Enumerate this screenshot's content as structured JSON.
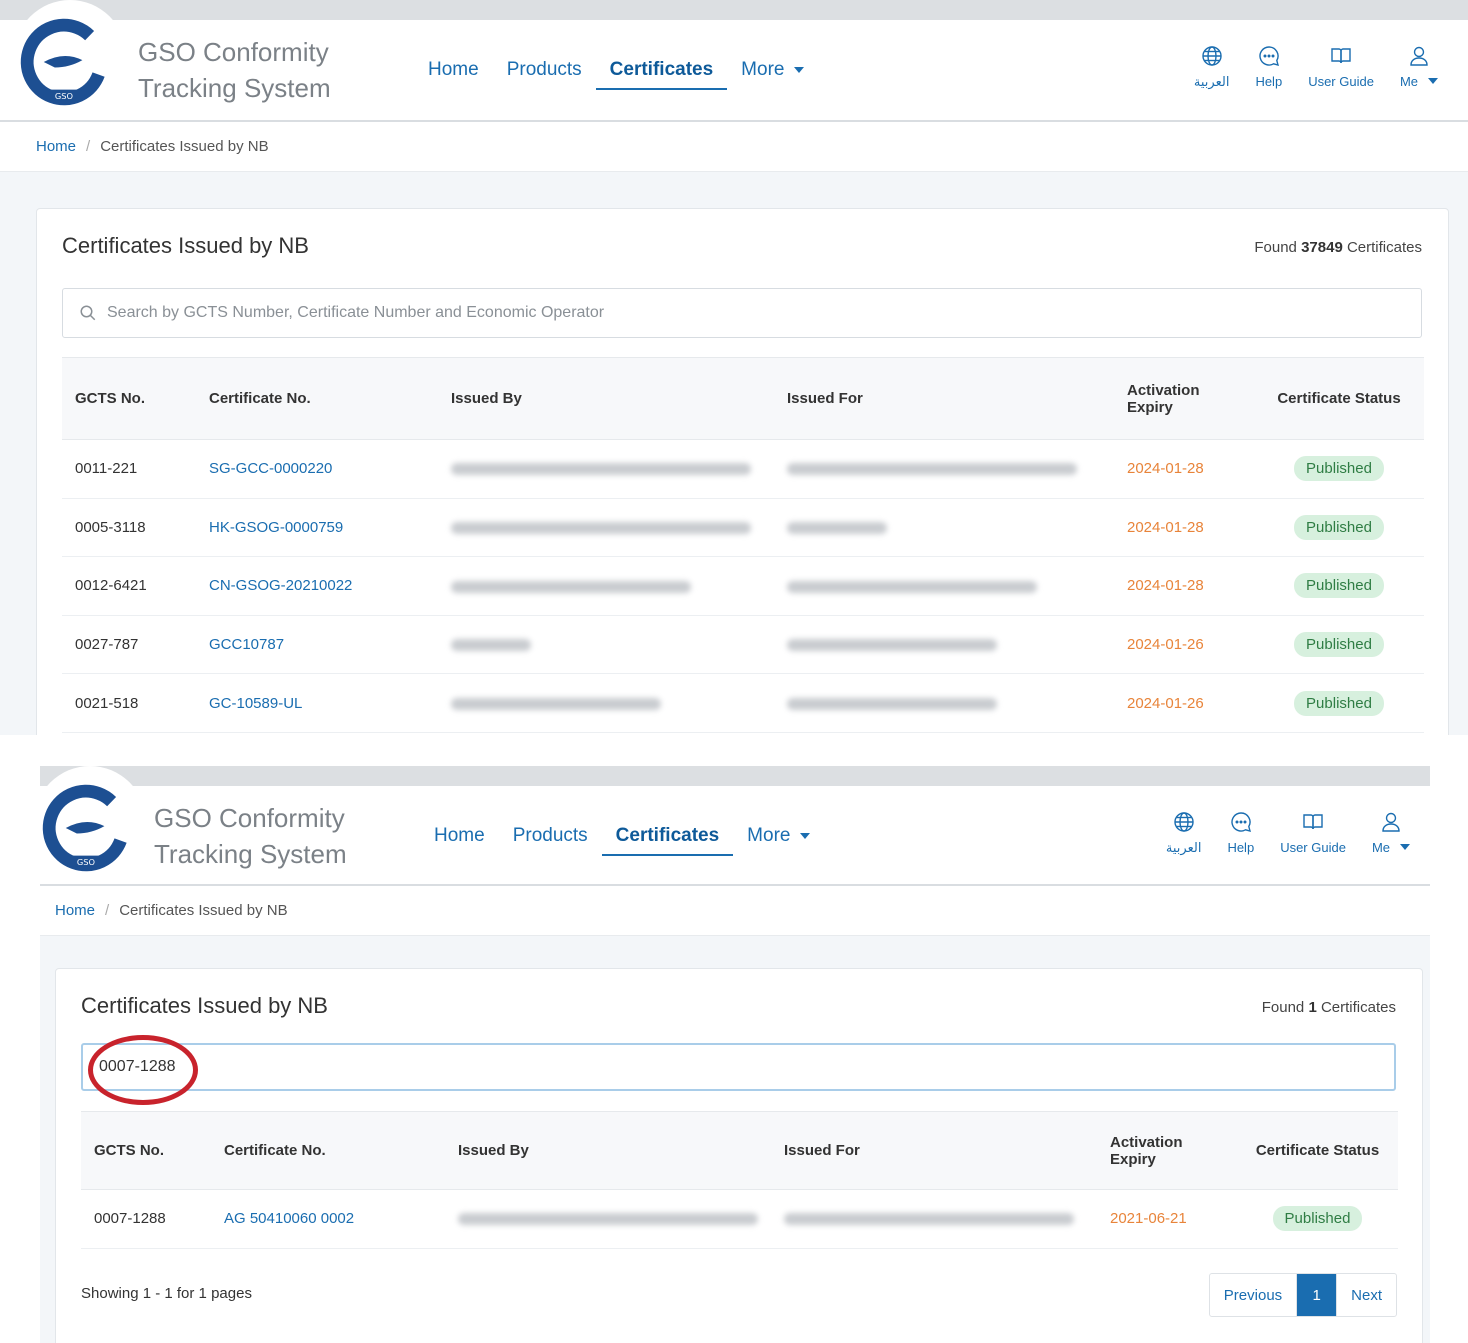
{
  "brand": {
    "line1": "GSO Conformity",
    "line2": "Tracking System",
    "logo_text": "GSO"
  },
  "nav": [
    {
      "label": "Home",
      "active": false
    },
    {
      "label": "Products",
      "active": false
    },
    {
      "label": "Certificates",
      "active": true
    },
    {
      "label": "More",
      "dropdown": true
    }
  ],
  "utils": {
    "language": "العربية",
    "help": "Help",
    "user_guide": "User Guide",
    "me": "Me"
  },
  "breadcrumb": {
    "home": "Home",
    "separator": "/",
    "current": "Certificates Issued by NB"
  },
  "columns": [
    "GCTS No.",
    "Certificate No.",
    "Issued By",
    "Issued For",
    "Activation Expiry",
    "Certificate Status"
  ],
  "colors": {
    "link": "#1a6db0",
    "date": "#e8843a",
    "badge_bg": "#d7f0de",
    "badge_text": "#2f7d44",
    "annotation": "#c8232c"
  },
  "screen1": {
    "title": "Certificates Issued by NB",
    "found_prefix": "Found",
    "found_count": "37849",
    "found_suffix": "Certificates",
    "search_placeholder": "Search by GCTS Number, Certificate Number and Economic Operator",
    "rows": [
      {
        "gcts": "0011-221",
        "cert": "SG-GCC-0000220",
        "expiry": "2024-01-28",
        "status": "Published"
      },
      {
        "gcts": "0005-3118",
        "cert": "HK-GSOG-0000759",
        "expiry": "2024-01-28",
        "status": "Published"
      },
      {
        "gcts": "0012-6421",
        "cert": "CN-GSOG-20210022",
        "expiry": "2024-01-28",
        "status": "Published"
      },
      {
        "gcts": "0027-787",
        "cert": "GCC10787",
        "expiry": "2024-01-26",
        "status": "Published"
      },
      {
        "gcts": "0021-518",
        "cert": "GC-10589-UL",
        "expiry": "2024-01-26",
        "status": "Published"
      }
    ]
  },
  "screen2": {
    "title": "Certificates Issued by NB",
    "found_prefix": "Found",
    "found_count": "1",
    "found_suffix": "Certificates",
    "search_value": "0007-1288",
    "rows": [
      {
        "gcts": "0007-1288",
        "cert": "AG 50410060 0002",
        "expiry": "2021-06-21",
        "status": "Published"
      }
    ],
    "showing": "Showing 1 - 1 for 1 pages",
    "pagination": {
      "previous": "Previous",
      "current": "1",
      "next": "Next"
    }
  }
}
